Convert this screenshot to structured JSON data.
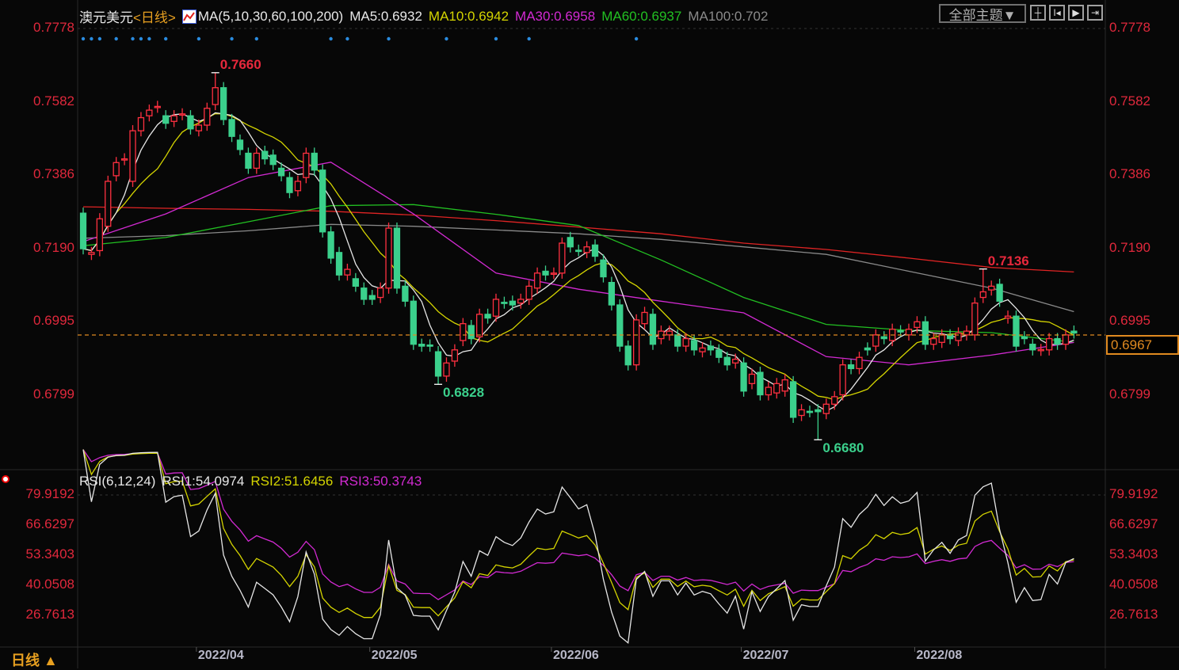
{
  "header": {
    "symbol": "澳元美元",
    "period": "<日线>",
    "ma_label": "MA(5,10,30,60,100,200)",
    "ma5": "MA5:0.6932",
    "ma10": "MA10:0.6942",
    "ma30": "MA30:0.6958",
    "ma60": "MA60:0.6937",
    "ma100": "MA100:0.702"
  },
  "toolbar": {
    "theme_button": "全部主题▼",
    "icons": [
      "crosshair-icon",
      "zoom-range-icon",
      "play-icon",
      "exit-icon"
    ]
  },
  "rsi_header": {
    "label": "RSI(6,12,24)",
    "rsi1": "RSI1:54.0974",
    "rsi2": "RSI2:51.6456",
    "rsi3": "RSI3:50.3743"
  },
  "footer": {
    "period_label": "日线 ▲"
  },
  "current_price": "0.6967",
  "colors": {
    "up": "#ff3040",
    "down": "#3bd08c",
    "ma5": "#e6e6e6",
    "ma10": "#d4d400",
    "ma30": "#d22ad2",
    "ma60": "#22c022",
    "ma100": "#8a8a8a",
    "ma200": "#e02424",
    "rsi1": "#e6e6e6",
    "rsi2": "#d4d400",
    "rsi3": "#d22ad2",
    "axis": "#e0283c",
    "current": "#e08a20"
  },
  "chart_data": {
    "type": "candlestick",
    "title": "澳元美元 日线",
    "price_ticks": [
      "0.7778",
      "0.7582",
      "0.7386",
      "0.7190",
      "0.6995",
      "0.6799"
    ],
    "ylim": [
      0.6799,
      0.7778
    ],
    "x_labels": [
      {
        "label": "2022/04",
        "index": 14
      },
      {
        "label": "2022/05",
        "index": 35
      },
      {
        "label": "2022/06",
        "index": 57
      },
      {
        "label": "2022/07",
        "index": 80
      },
      {
        "label": "2022/08",
        "index": 101
      }
    ],
    "default_wick": 0.0015,
    "candles_oc": [
      [
        0.7285,
        0.719
      ],
      [
        0.7175,
        0.718
      ],
      [
        0.7185,
        0.727
      ],
      [
        0.725,
        0.737
      ],
      [
        0.7385,
        0.742
      ],
      [
        0.7428,
        0.743
      ],
      [
        0.737,
        0.7505
      ],
      [
        0.7505,
        0.754
      ],
      [
        0.7545,
        0.756
      ],
      [
        0.7568,
        0.757
      ],
      [
        0.7545,
        0.7525
      ],
      [
        0.753,
        0.7545
      ],
      [
        0.7548,
        0.755
      ],
      [
        0.7545,
        0.751
      ],
      [
        0.7505,
        0.752
      ],
      [
        0.752,
        0.7565
      ],
      [
        0.7575,
        0.762
      ],
      [
        0.762,
        0.7535
      ],
      [
        0.7535,
        0.749
      ],
      [
        0.748,
        0.7455
      ],
      [
        0.7445,
        0.7405
      ],
      [
        0.7405,
        0.7445
      ],
      [
        0.745,
        0.743
      ],
      [
        0.744,
        0.7415
      ],
      [
        0.7405,
        0.7385
      ],
      [
        0.738,
        0.734
      ],
      [
        0.7345,
        0.737
      ],
      [
        0.738,
        0.7445
      ],
      [
        0.7445,
        0.74
      ],
      [
        0.74,
        0.7235
      ],
      [
        0.7235,
        0.7165
      ],
      [
        0.718,
        0.712
      ],
      [
        0.712,
        0.7135
      ],
      [
        0.711,
        0.709
      ],
      [
        0.7085,
        0.7055
      ],
      [
        0.7065,
        0.7055
      ],
      [
        0.706,
        0.7085
      ],
      [
        0.7085,
        0.7245
      ],
      [
        0.7245,
        0.7085
      ],
      [
        0.709,
        0.705
      ],
      [
        0.705,
        0.6935
      ],
      [
        0.6935,
        0.693
      ],
      [
        0.6933,
        0.693
      ],
      [
        0.6915,
        0.685
      ],
      [
        0.685,
        0.6885
      ],
      [
        0.689,
        0.692
      ],
      [
        0.6945,
        0.699
      ],
      [
        0.6985,
        0.695
      ],
      [
        0.6955,
        0.7015
      ],
      [
        0.7015,
        0.7005
      ],
      [
        0.701,
        0.7055
      ],
      [
        0.7047,
        0.7045
      ],
      [
        0.705,
        0.704
      ],
      [
        0.7045,
        0.7055
      ],
      [
        0.7055,
        0.709
      ],
      [
        0.7085,
        0.7125
      ],
      [
        0.713,
        0.712
      ],
      [
        0.7124,
        0.7125
      ],
      [
        0.7125,
        0.7205
      ],
      [
        0.722,
        0.7195
      ],
      [
        0.7186,
        0.7185
      ],
      [
        0.718,
        0.7195
      ],
      [
        0.72,
        0.717
      ],
      [
        0.716,
        0.7115
      ],
      [
        0.71,
        0.704
      ],
      [
        0.704,
        0.693
      ],
      [
        0.693,
        0.688
      ],
      [
        0.688,
        0.7
      ],
      [
        0.699,
        0.702
      ],
      [
        0.7015,
        0.6935
      ],
      [
        0.695,
        0.697
      ],
      [
        0.696,
        0.697
      ],
      [
        0.696,
        0.693
      ],
      [
        0.693,
        0.695
      ],
      [
        0.6945,
        0.692
      ],
      [
        0.6915,
        0.6925
      ],
      [
        0.693,
        0.692
      ],
      [
        0.692,
        0.69
      ],
      [
        0.69,
        0.688
      ],
      [
        0.6885,
        0.6895
      ],
      [
        0.6885,
        0.681
      ],
      [
        0.683,
        0.6855
      ],
      [
        0.686,
        0.68
      ],
      [
        0.68,
        0.682
      ],
      [
        0.6805,
        0.683
      ],
      [
        0.681,
        0.684
      ],
      [
        0.6835,
        0.674
      ],
      [
        0.6745,
        0.676
      ],
      [
        0.6756,
        0.6755
      ],
      [
        0.676,
        0.6755
      ],
      [
        0.675,
        0.6775
      ],
      [
        0.6775,
        0.6795
      ],
      [
        0.68,
        0.688
      ],
      [
        0.688,
        0.687
      ],
      [
        0.687,
        0.69
      ],
      [
        0.6925,
        0.692
      ],
      [
        0.693,
        0.696
      ],
      [
        0.6955,
        0.695
      ],
      [
        0.6945,
        0.6975
      ],
      [
        0.6971,
        0.697
      ],
      [
        0.696,
        0.6975
      ],
      [
        0.698,
        0.6995
      ],
      [
        0.6995,
        0.6935
      ],
      [
        0.6935,
        0.695
      ],
      [
        0.694,
        0.696
      ],
      [
        0.696,
        0.695
      ],
      [
        0.6945,
        0.6965
      ],
      [
        0.696,
        0.697
      ],
      [
        0.696,
        0.7045
      ],
      [
        0.706,
        0.7075
      ],
      [
        0.708,
        0.709
      ],
      [
        0.7095,
        0.705
      ],
      [
        0.7005,
        0.701
      ],
      [
        0.701,
        0.693
      ],
      [
        0.6955,
        0.695
      ],
      [
        0.6935,
        0.692
      ],
      [
        0.6919,
        0.6921
      ],
      [
        0.692,
        0.695
      ],
      [
        0.695,
        0.6935
      ],
      [
        0.6935,
        0.696
      ],
      [
        0.697,
        0.6965
      ]
    ],
    "extremes": [
      {
        "index": 16,
        "high": 0.766,
        "label": "0.7660",
        "kind": "high"
      },
      {
        "index": 43,
        "low": 0.6828,
        "label": "0.6828",
        "kind": "low"
      },
      {
        "index": 89,
        "low": 0.668,
        "label": "0.6680",
        "kind": "low"
      },
      {
        "index": 109,
        "high": 0.7136,
        "label": "0.7136",
        "kind": "high"
      }
    ],
    "signal_dots": [
      0,
      1,
      2,
      4,
      6,
      7,
      8,
      10,
      14,
      18,
      21,
      30,
      32,
      37,
      44,
      50,
      54,
      67
    ],
    "ma_sampled_every": 10,
    "ma30": [
      0.7209,
      0.7283,
      0.738,
      0.7421,
      0.7283,
      0.7125,
      0.7082,
      0.705,
      0.7019,
      0.6902,
      0.688,
      0.6906,
      0.694
    ],
    "ma60": [
      0.7198,
      0.722,
      0.7262,
      0.7305,
      0.7308,
      0.7282,
      0.7252,
      0.716,
      0.706,
      0.6988,
      0.6972,
      0.6966,
      0.694
    ],
    "ma100": [
      0.7218,
      0.7225,
      0.7238,
      0.7255,
      0.725,
      0.724,
      0.723,
      0.7215,
      0.7195,
      0.7175,
      0.713,
      0.7085,
      0.7022
    ],
    "ma200": [
      0.7302,
      0.7298,
      0.7295,
      0.729,
      0.728,
      0.7265,
      0.7248,
      0.723,
      0.7205,
      0.7188,
      0.7165,
      0.714,
      0.7128
    ],
    "rsi_ticks": [
      "79.9192",
      "66.6297",
      "53.3403",
      "40.0508",
      "26.7613"
    ],
    "rsi_periods": [
      6,
      12,
      24
    ]
  }
}
